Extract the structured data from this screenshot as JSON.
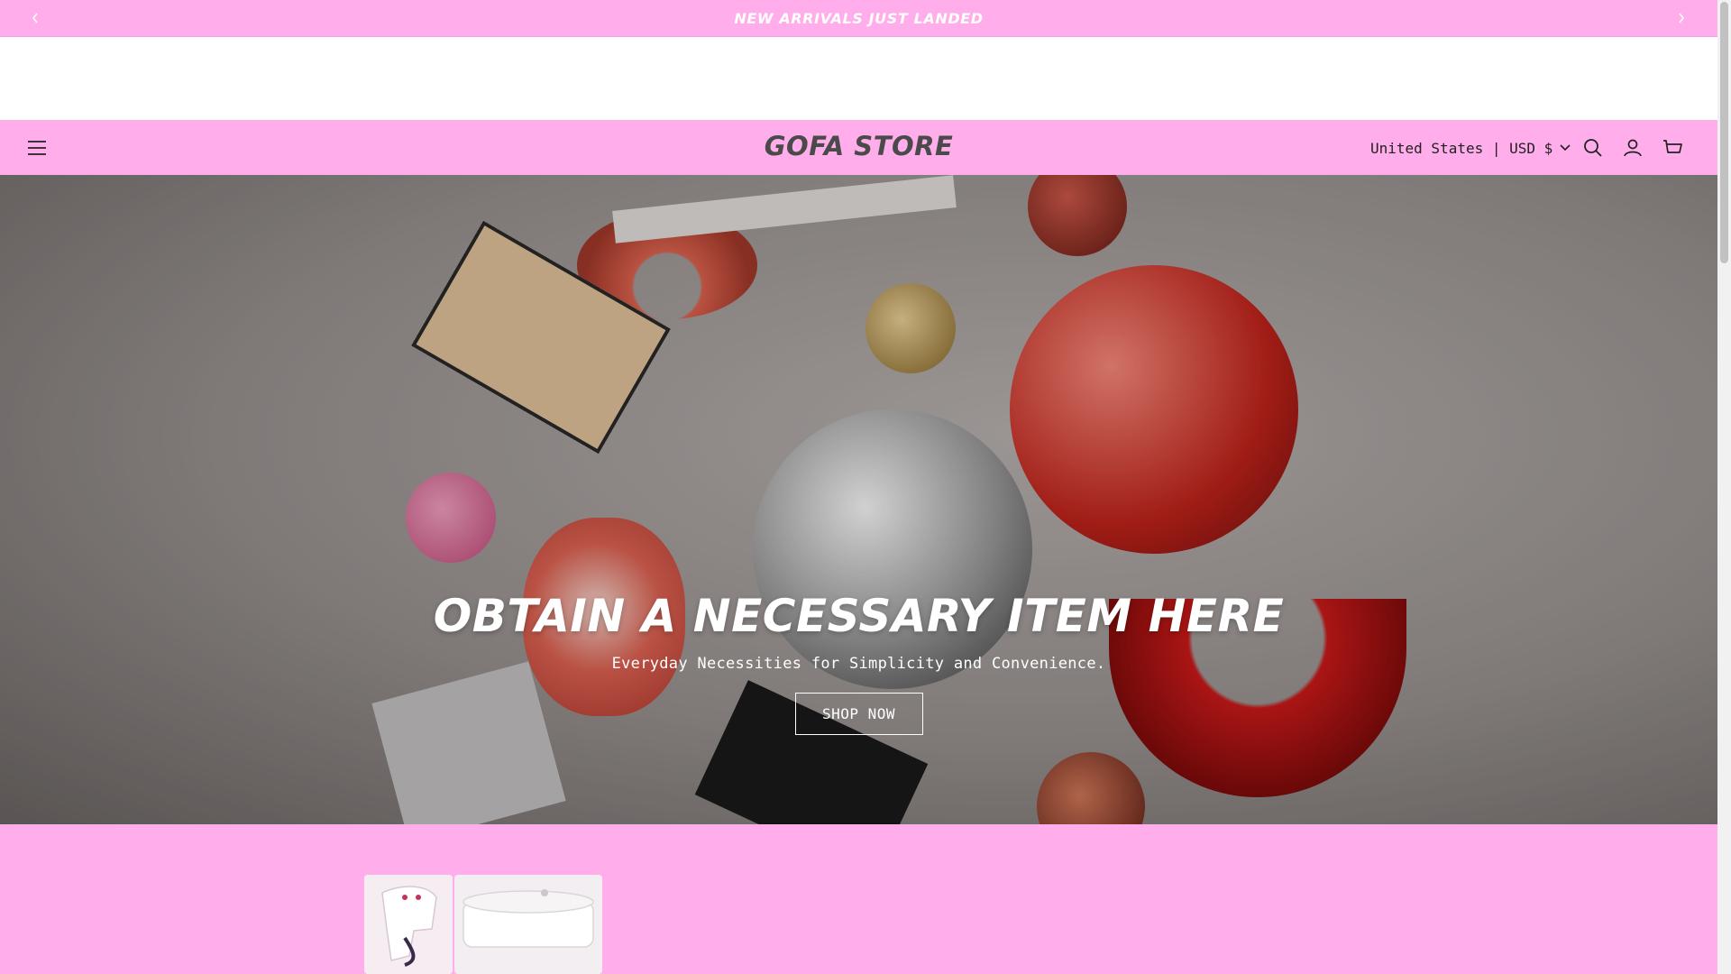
{
  "announcement": {
    "text": "NEW ARRIVALS JUST LANDED",
    "prev_icon": "chevron-left-icon",
    "next_icon": "chevron-right-icon"
  },
  "header": {
    "logo": "GOFA STORE",
    "locale_label": "United States | USD $",
    "icons": [
      "hamburger-menu-icon",
      "search-icon",
      "account-icon",
      "cart-icon"
    ]
  },
  "hero": {
    "title": "OBTAIN A NECESSARY ITEM HERE",
    "subtitle": "Everyday Necessities for Simplicity and Convenience.",
    "button_label": "SHOP NOW"
  },
  "colors": {
    "brand_pink": "#ffadeb",
    "text_dark": "#4a4a4a",
    "white": "#ffffff"
  }
}
